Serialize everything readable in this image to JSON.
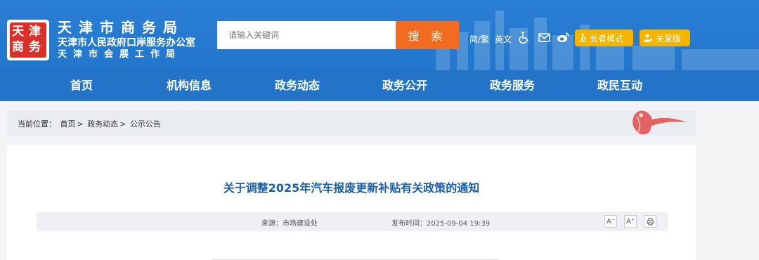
{
  "header": {
    "logo_text": "天津商务",
    "org_name": "天津市商务局",
    "org_sub1": "天津市人民政府口岸服务办公室",
    "org_sub2": "天津市会展工作局"
  },
  "search": {
    "placeholder": "请输入关键词",
    "button_label": "搜 索"
  },
  "toolbar": {
    "lang_simple_trad": "简/繁",
    "lang_english": "英文",
    "icons": [
      "accessibility-icon",
      "mail-icon",
      "weibo-icon"
    ],
    "elder_mode_label": "长者模式",
    "care_mode_label": "关爱版"
  },
  "nav": {
    "items": [
      {
        "label": "首页"
      },
      {
        "label": "机构信息"
      },
      {
        "label": "政务动态"
      },
      {
        "label": "政务公开"
      },
      {
        "label": "政务服务"
      },
      {
        "label": "政民互动"
      }
    ]
  },
  "breadcrumb": {
    "prefix": "当前位置：",
    "items": [
      "首页",
      "政务动态",
      "公示公告"
    ],
    "separator": ">"
  },
  "article": {
    "title": "关于调整2025年汽车报废更新补贴有关政策的通知",
    "source": "来源：市场建设处",
    "publish_time": "发布时间：2025-09-04 19:39",
    "font_decrease": "A⁻",
    "font_increase": "A⁺",
    "print_icon": "print-icon"
  },
  "colors": {
    "header_blue": "#2a7fd4",
    "nav_blue": "#2374c8",
    "search_orange": "#f36a21",
    "mode_yellow": "#f5b400",
    "title_blue": "#1b5fa8",
    "logo_red": "#d9302a"
  }
}
